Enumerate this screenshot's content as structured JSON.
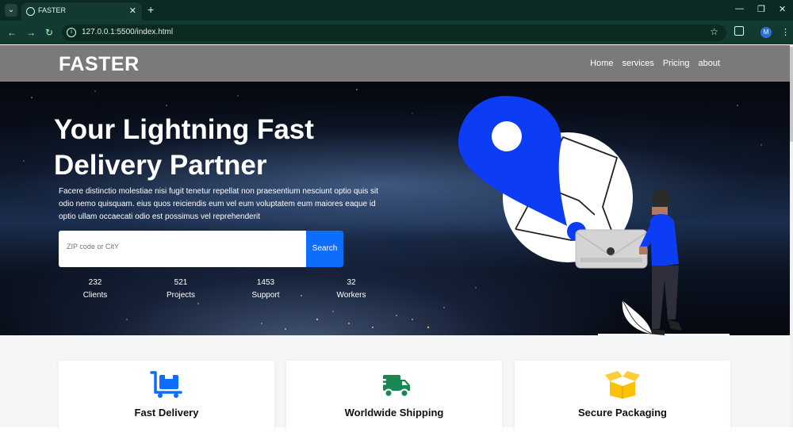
{
  "browser": {
    "tab_title": "FASTER",
    "url": "127.0.0.1:5500/index.html",
    "profile_initial": "M"
  },
  "nav": {
    "brand": "FASTER",
    "links": [
      "Home",
      "services",
      "Pricing",
      "about"
    ]
  },
  "hero": {
    "title_line1": "Your Lightning Fast",
    "title_line2": "Delivery Partner",
    "description": "Facere distinctio molestiae nisi fugit tenetur repellat non praesentium nesciunt optio quis sit odio nemo quisquam. eius quos reiciendis eum vel eum voluptatem eum maiores eaque id optio ullam occaecati odio est possimus vel reprehenderit",
    "search_placeholder": "ZIP code or CitY",
    "search_button": "Search",
    "stats": [
      {
        "value": "232",
        "label": "Clients"
      },
      {
        "value": "521",
        "label": "Projects"
      },
      {
        "value": "1453",
        "label": "Support"
      },
      {
        "value": "32",
        "label": "Workers"
      }
    ]
  },
  "services": [
    {
      "title": "Fast Delivery",
      "icon": "cart-icon",
      "color": "#0d6efd"
    },
    {
      "title": "Worldwide Shipping",
      "icon": "truck-fast-icon",
      "color": "#198754"
    },
    {
      "title": "Secure Packaging",
      "icon": "box-open-icon",
      "color": "#ffc107"
    }
  ]
}
